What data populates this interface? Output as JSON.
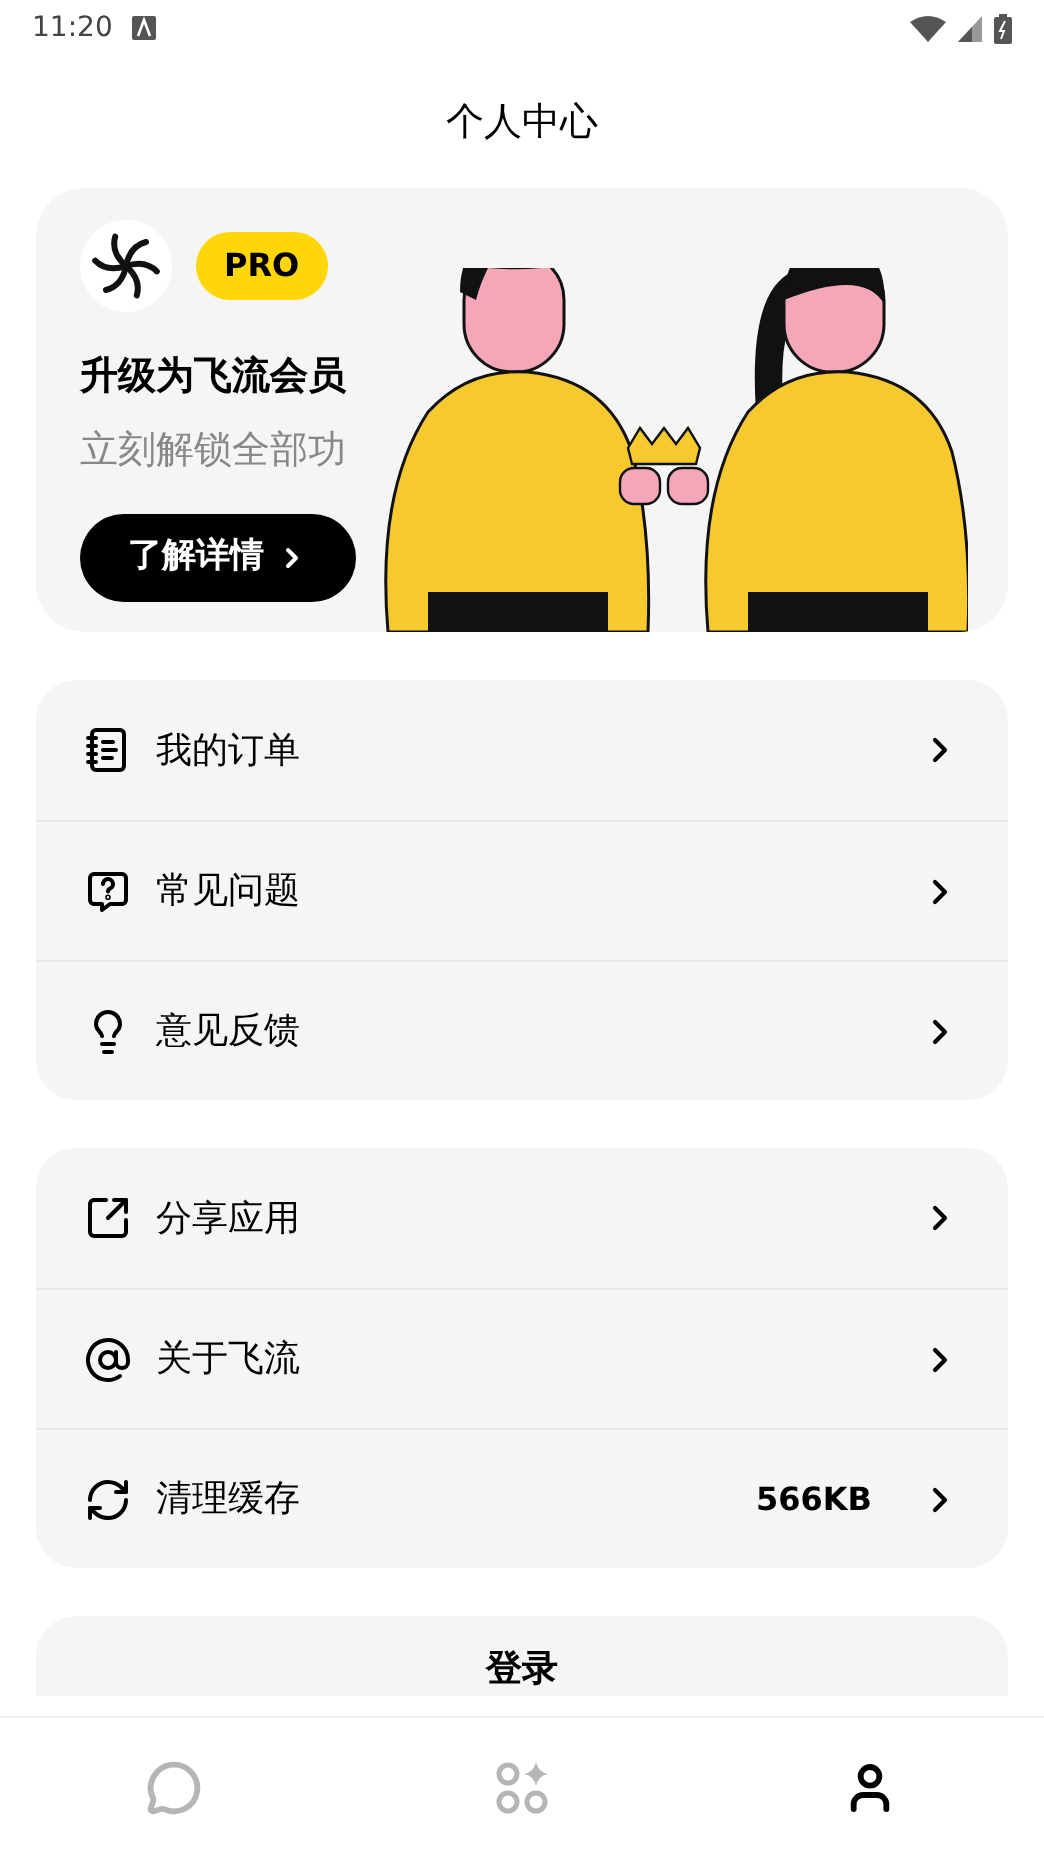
{
  "status_bar": {
    "time": "11:20"
  },
  "header": {
    "title": "个人中心"
  },
  "promo": {
    "badge": "PRO",
    "title": "升级为飞流会员",
    "subtitle": "立刻解锁全部功",
    "button": "了解详情"
  },
  "menu_groups": [
    [
      {
        "label": "我的订单"
      },
      {
        "label": "常见问题"
      },
      {
        "label": "意见反馈"
      }
    ],
    [
      {
        "label": "分享应用"
      },
      {
        "label": "关于飞流"
      },
      {
        "label": "清理缓存",
        "value": "566KB"
      }
    ]
  ],
  "login": {
    "label": "登录"
  },
  "bottom_nav": [
    {
      "selected": false
    },
    {
      "selected": false
    },
    {
      "selected": true
    }
  ]
}
